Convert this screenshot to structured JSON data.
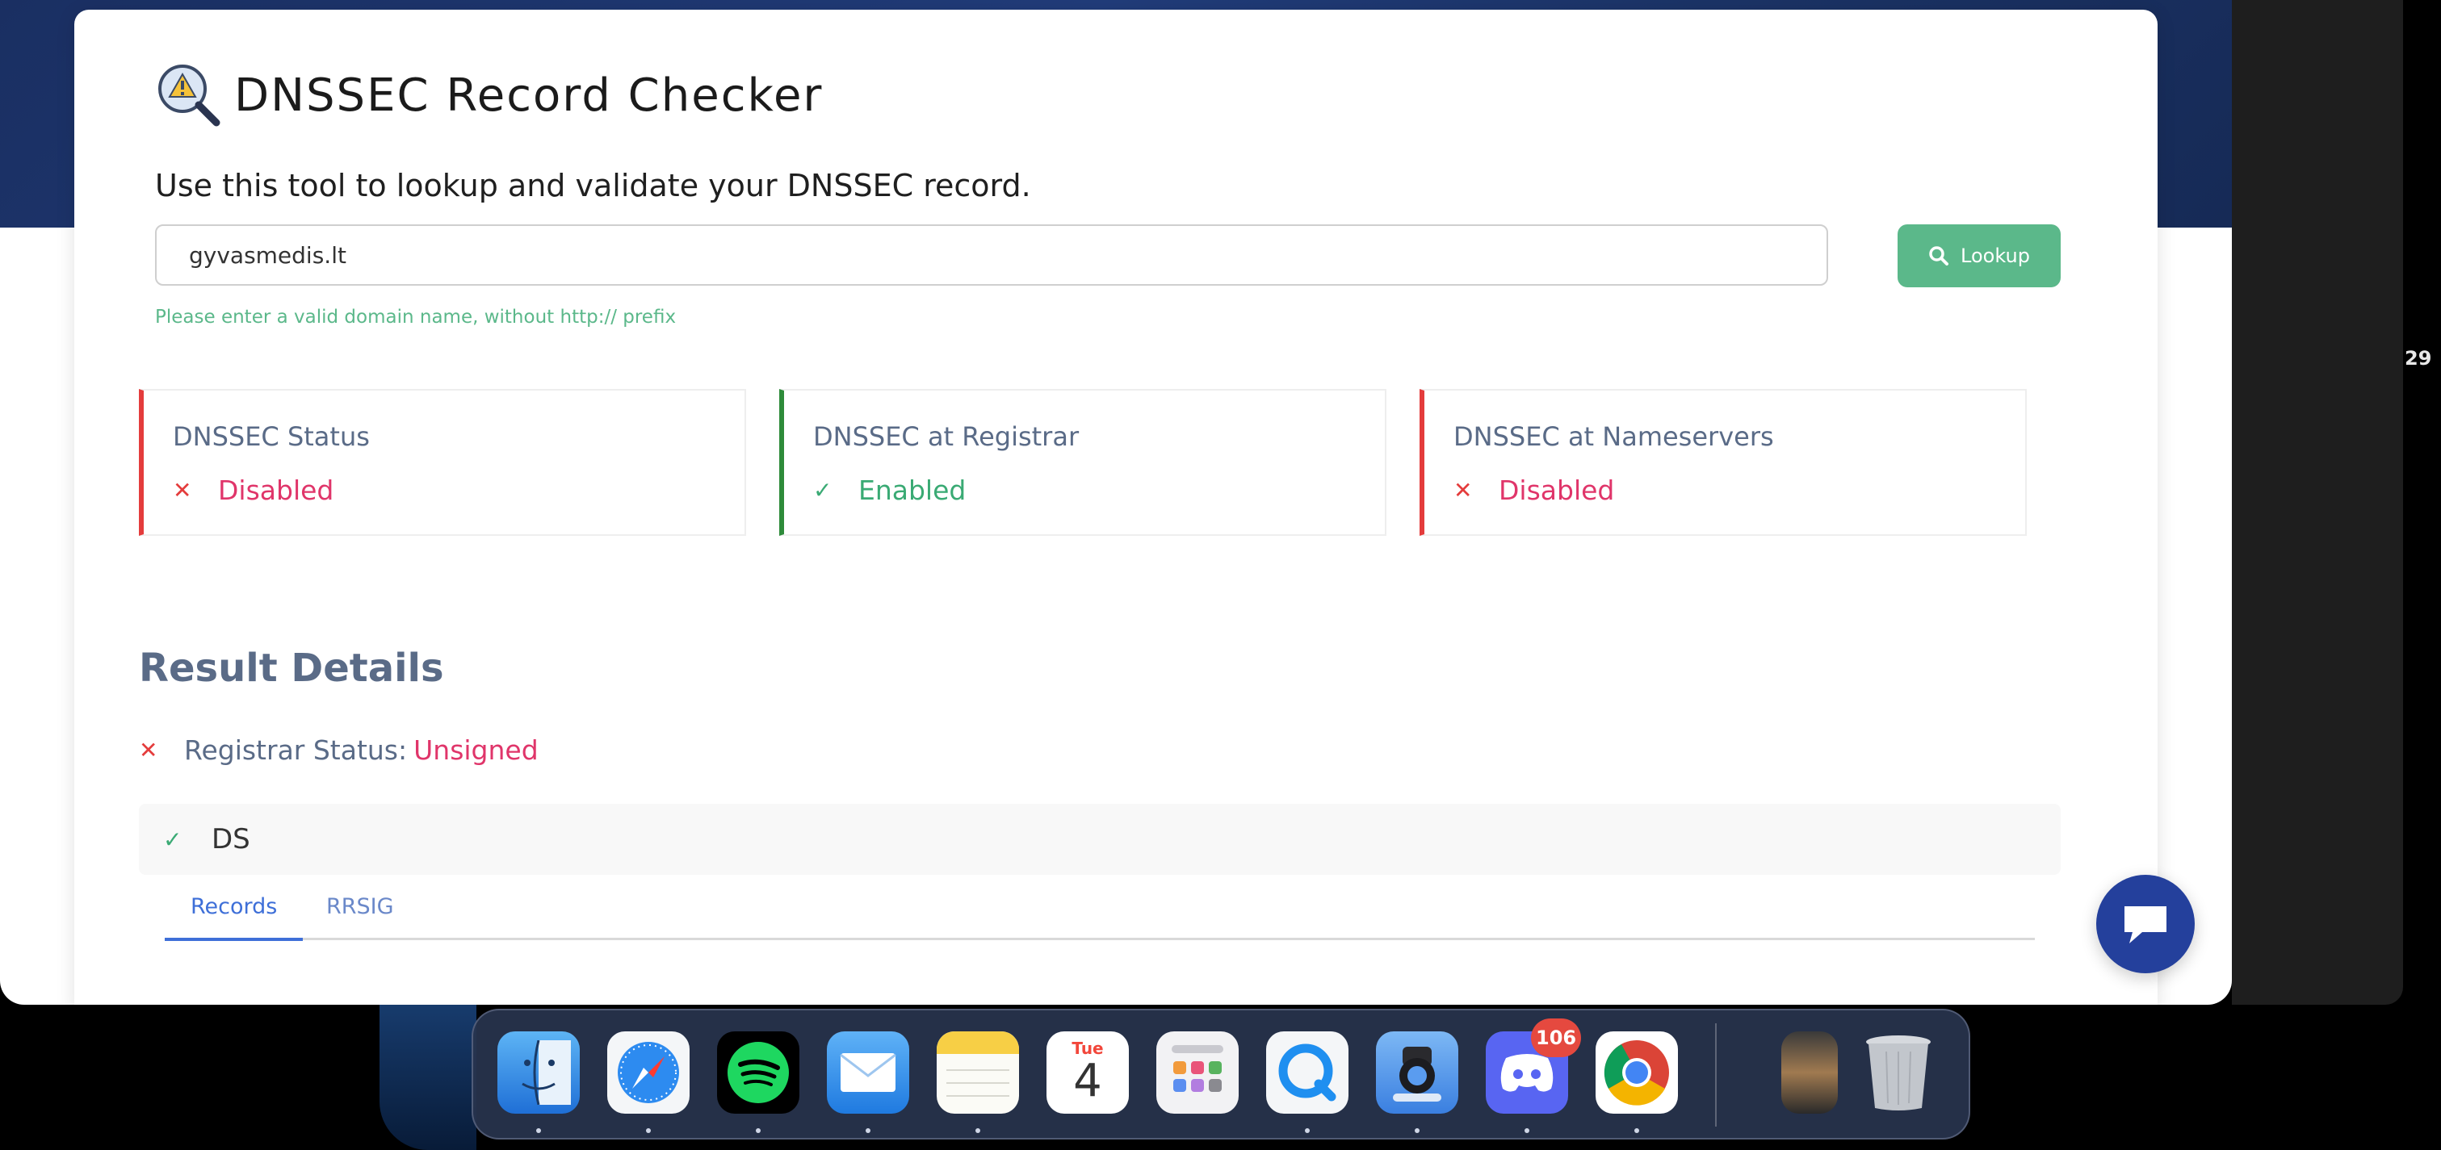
{
  "page": {
    "title": "DNSSEC Record Checker",
    "subtitle": "Use this tool to lookup and validate your DNSSEC record."
  },
  "search": {
    "value": "gyvasmedis.lt",
    "button_label": "Lookup",
    "hint": "Please enter a valid domain name, without http:// prefix"
  },
  "status_cards": [
    {
      "title": "DNSSEC Status",
      "mark": "✕",
      "value": "Disabled",
      "state": "error"
    },
    {
      "title": "DNSSEC at Registrar",
      "mark": "✓",
      "value": "Enabled",
      "state": "ok"
    },
    {
      "title": "DNSSEC at Nameservers",
      "mark": "✕",
      "value": "Disabled",
      "state": "error"
    }
  ],
  "results": {
    "title": "Result Details",
    "registrar_mark": "✕",
    "registrar_label": "Registrar Status:",
    "registrar_value": "Unsigned",
    "ds_mark": "✓",
    "ds_label": "DS",
    "tabs": [
      "Records",
      "RRSIG"
    ]
  },
  "system": {
    "right_edge_text": "29",
    "dock": {
      "apps": [
        "finder",
        "safari",
        "spotify",
        "mail",
        "notes",
        "calendar",
        "launchpad",
        "quicktime",
        "preview",
        "discord",
        "chrome",
        "recent-window",
        "trash"
      ],
      "calendar_day": "Tue",
      "calendar_date": "4",
      "discord_badge": "106"
    }
  },
  "colors": {
    "accent_green": "#5bb88a",
    "error_red": "#e43c3c",
    "error_pink": "#e0356a",
    "ok_green": "#3aaa74",
    "tab_blue": "#3e6fd8",
    "chat_blue": "#24409c"
  }
}
